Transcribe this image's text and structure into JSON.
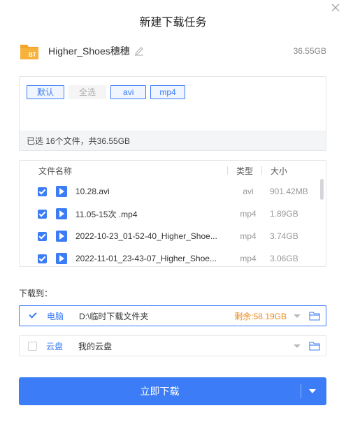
{
  "dialog": {
    "title": "新建下载任务"
  },
  "task": {
    "name": "Higher_Shoes穗穗",
    "size": "36.55GB",
    "icon_label": "BT",
    "icon_color": "#f4a52a"
  },
  "filters": [
    {
      "label": "默认",
      "state": "selected"
    },
    {
      "label": "全选",
      "state": "unselected"
    },
    {
      "label": "avi",
      "state": "selected"
    },
    {
      "label": "mp4",
      "state": "selected"
    }
  ],
  "selection_summary": "已选 16个文件，共36.55GB",
  "file_list": {
    "headers": {
      "name": "文件名称",
      "type": "类型",
      "size": "大小"
    },
    "rows": [
      {
        "name": "10.28.avi",
        "type": "avi",
        "size": "901.42MB",
        "checked": true
      },
      {
        "name": "11.05-15次 .mp4",
        "type": "mp4",
        "size": "1.89GB",
        "checked": true
      },
      {
        "name": "2022-10-23_01-52-40_Higher_Shoe...",
        "type": "mp4",
        "size": "3.74GB",
        "checked": true
      },
      {
        "name": "2022-11-01_23-43-07_Higher_Shoe...",
        "type": "mp4",
        "size": "3.06GB",
        "checked": true
      }
    ]
  },
  "download_to": {
    "label": "下载到：",
    "local": {
      "name": "电脑",
      "path": "D:\\临时下载文件夹",
      "free": "剩余:58.19GB",
      "checked": true
    },
    "cloud": {
      "name": "云盘",
      "path": "我的云盘",
      "checked": false
    }
  },
  "download_button": {
    "label": "立即下载"
  },
  "colors": {
    "accent": "#3c7cf6",
    "warning": "#e8891a"
  }
}
